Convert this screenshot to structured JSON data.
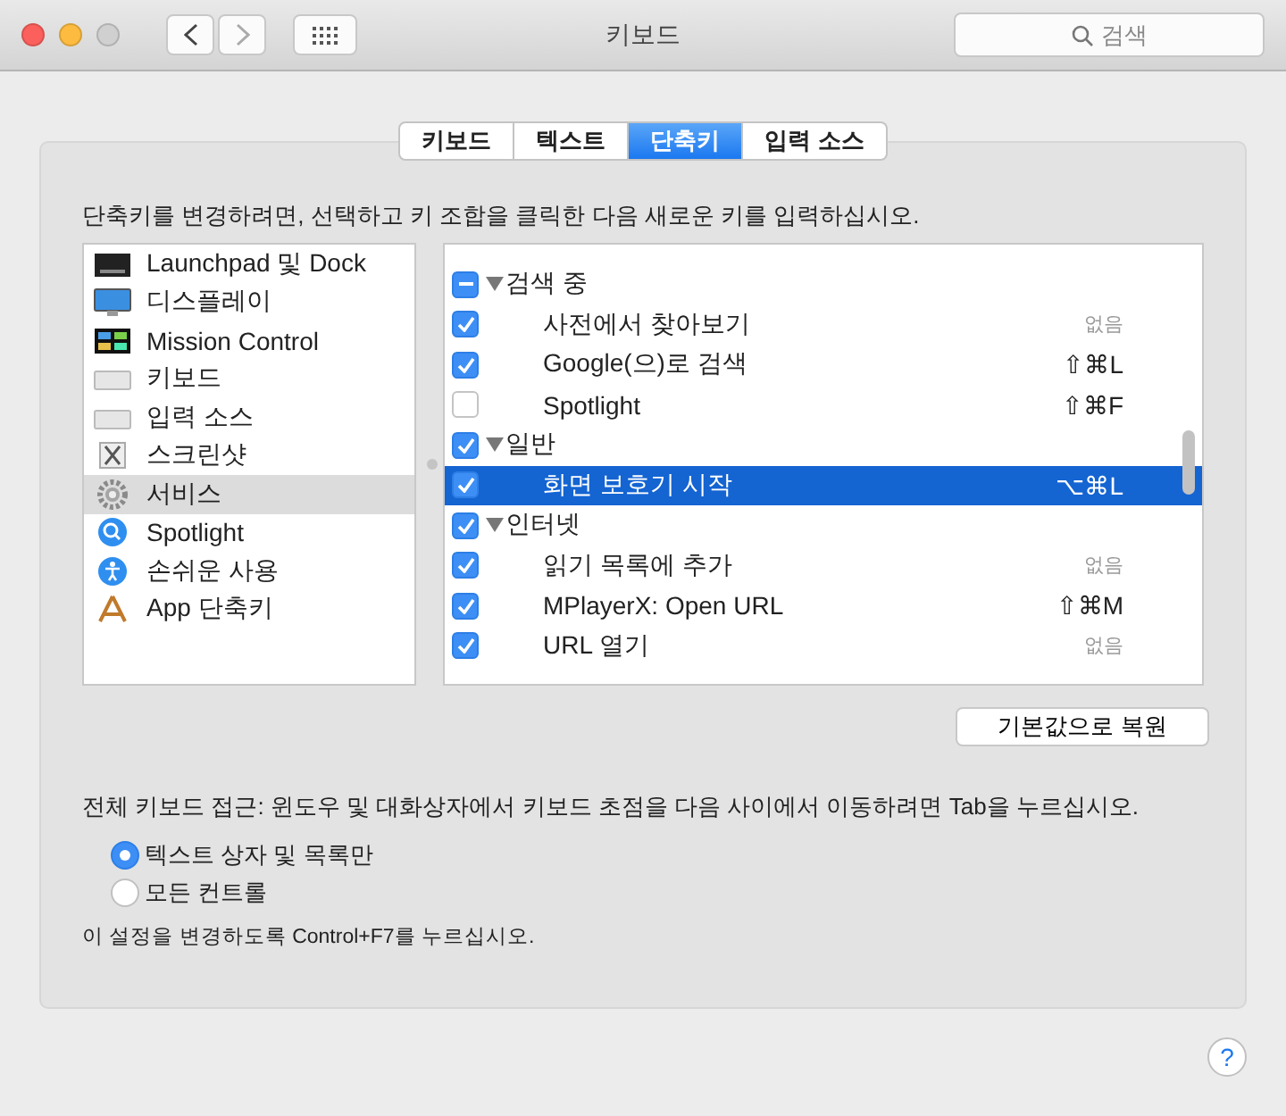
{
  "window": {
    "title": "키보드"
  },
  "search": {
    "placeholder": "검색"
  },
  "tabs": [
    {
      "label": "키보드",
      "selected": false
    },
    {
      "label": "텍스트",
      "selected": false
    },
    {
      "label": "단축키",
      "selected": true
    },
    {
      "label": "입력 소스",
      "selected": false
    }
  ],
  "instruction": "단축키를 변경하려면, 선택하고 키 조합을 클릭한 다음 새로운 키를 입력하십시오.",
  "categories": [
    {
      "label": "Launchpad 및 Dock",
      "selected": false
    },
    {
      "label": "디스플레이",
      "selected": false
    },
    {
      "label": "Mission Control",
      "selected": false
    },
    {
      "label": "키보드",
      "selected": false
    },
    {
      "label": "입력 소스",
      "selected": false
    },
    {
      "label": "스크린샷",
      "selected": false
    },
    {
      "label": "서비스",
      "selected": true
    },
    {
      "label": "Spotlight",
      "selected": false
    },
    {
      "label": "손쉬운 사용",
      "selected": false
    },
    {
      "label": "App 단축키",
      "selected": false
    }
  ],
  "shortcuts": [
    {
      "kind": "group",
      "label": "검색 중",
      "checked": true,
      "mixed": true,
      "selected": false,
      "children": [
        {
          "kind": "item",
          "label": "사전에서 찾아보기",
          "checked": true,
          "selected": false,
          "shortcut": "없음",
          "unset": true
        },
        {
          "kind": "item",
          "label": "Google(으)로 검색",
          "checked": true,
          "selected": false,
          "shortcut": "⇧⌘L",
          "unset": false
        },
        {
          "kind": "item",
          "label": "Spotlight",
          "checked": false,
          "selected": false,
          "shortcut": "⇧⌘F",
          "unset": false
        }
      ]
    },
    {
      "kind": "group",
      "label": "일반",
      "checked": true,
      "mixed": false,
      "selected": false,
      "children": [
        {
          "kind": "item",
          "label": "화면 보호기 시작",
          "checked": true,
          "selected": true,
          "shortcut": "⌥⌘L",
          "unset": false
        }
      ]
    },
    {
      "kind": "group",
      "label": "인터넷",
      "checked": true,
      "mixed": false,
      "selected": false,
      "children": [
        {
          "kind": "item",
          "label": "읽기 목록에 추가",
          "checked": true,
          "selected": false,
          "shortcut": "없음",
          "unset": true
        },
        {
          "kind": "item",
          "label": "MPlayerX: Open URL",
          "checked": true,
          "selected": false,
          "shortcut": "⇧⌘M",
          "unset": false
        },
        {
          "kind": "item",
          "label": "URL 열기",
          "checked": true,
          "selected": false,
          "shortcut": "없음",
          "unset": true
        }
      ]
    }
  ],
  "restore_button": "기본값으로 복원",
  "keyboard_access": {
    "label": "전체 키보드 접근: 윈도우 및 대화상자에서 키보드 초점을 다음 사이에서 이동하려면 Tab을 누르십시오.",
    "options": [
      {
        "label": "텍스트 상자 및 목록만",
        "selected": true
      },
      {
        "label": "모든 컨트롤",
        "selected": false
      }
    ],
    "hint": "이 설정을 변경하도록 Control+F7를 누르십시오."
  },
  "help": "?"
}
